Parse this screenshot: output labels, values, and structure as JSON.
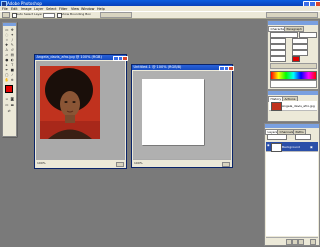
{
  "app": {
    "title": "Adobe Photoshop"
  },
  "menu": [
    "File",
    "Edit",
    "Image",
    "Layer",
    "Select",
    "Filter",
    "View",
    "Window",
    "Help"
  ],
  "options_bar": {
    "auto_select": "Auto Select Layer",
    "bounding_box": "Show Bounding Box"
  },
  "documents": [
    {
      "title": "Angela_davis_afro.jpg @ 100% (RGB)",
      "status": "100%"
    },
    {
      "title": "Untitled-1 @ 100% (RGB/8)",
      "status": "100%"
    }
  ],
  "panels": {
    "character_tabs": [
      "Character",
      "Paragraph"
    ],
    "history_tabs": [
      "History",
      "Actions"
    ],
    "history_item": "Angela_davis_afro.jpg",
    "layers_tabs": [
      "Layers",
      "Channels",
      "Paths"
    ],
    "layer_name": "Background"
  },
  "colors": {
    "foreground": "#e00000",
    "background": "#ffffff"
  }
}
